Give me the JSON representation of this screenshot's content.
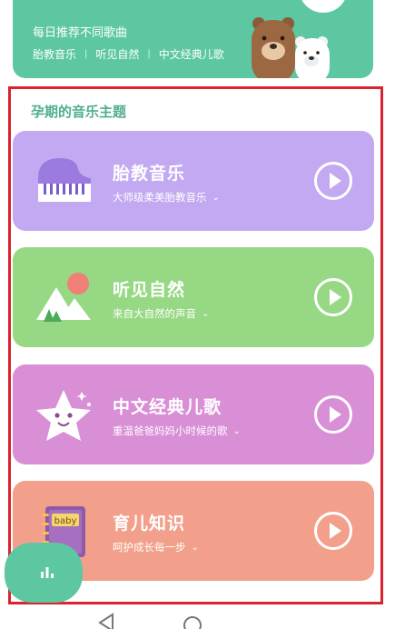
{
  "banner": {
    "title": "每日推荐不同歌曲",
    "categories": [
      "胎教音乐",
      "听见自然",
      "中文经典儿歌"
    ],
    "separator": "|"
  },
  "section": {
    "title": "孕期的音乐主题"
  },
  "cards": [
    {
      "title": "胎教音乐",
      "subtitle": "大师级柔美胎教音乐",
      "icon": "piano-icon",
      "color": "#c3a9f1"
    },
    {
      "title": "听见自然",
      "subtitle": "来自大自然的声音",
      "icon": "nature-mountain-icon",
      "color": "#97d885"
    },
    {
      "title": "中文经典儿歌",
      "subtitle": "重温爸爸妈妈小时候的歌",
      "icon": "star-face-icon",
      "color": "#d88fd6"
    },
    {
      "title": "育儿知识",
      "subtitle": "呵护成长每一步",
      "icon": "baby-book-icon",
      "color": "#f2a08b",
      "badge": "baby"
    }
  ],
  "colors": {
    "accent": "#5cc7a0",
    "frame": "#d9232e"
  }
}
